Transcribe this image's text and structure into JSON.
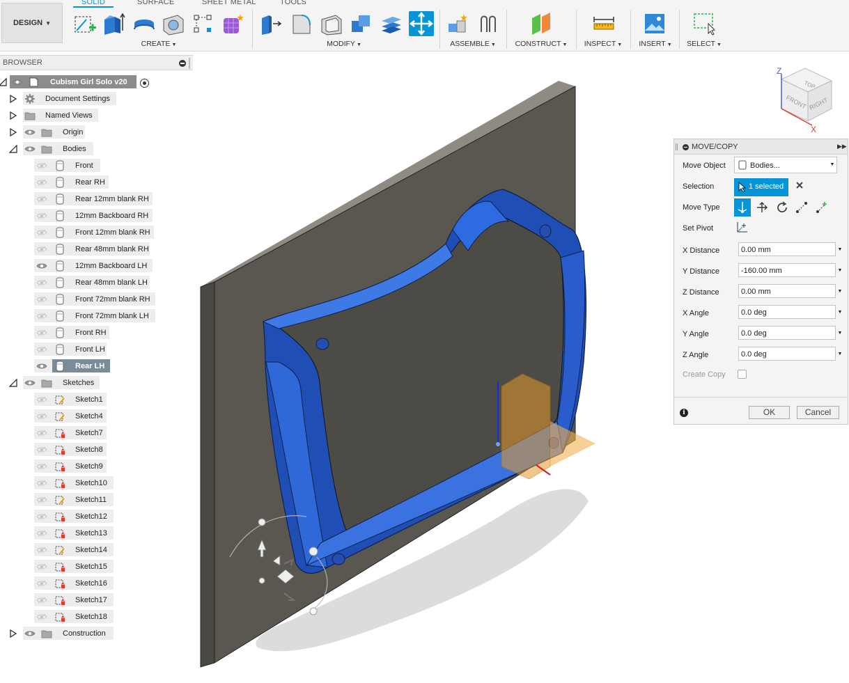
{
  "toolbar": {
    "design_label": "DESIGN",
    "tabs": [
      "SOLID",
      "SURFACE",
      "SHEET METAL",
      "TOOLS"
    ],
    "groups": [
      "CREATE",
      "MODIFY",
      "ASSEMBLE",
      "CONSTRUCT",
      "INSPECT",
      "INSERT",
      "SELECT"
    ]
  },
  "browser": {
    "header": "BROWSER",
    "root": "Cubism Girl Solo v20",
    "nodes": [
      "Document Settings",
      "Named Views",
      "Origin",
      "Bodies",
      "Sketches",
      "Construction"
    ],
    "bodies": [
      "Front",
      "Rear RH",
      "Rear 12mm blank RH",
      "12mm Backboard RH",
      "Front 12mm blank RH",
      "Rear 48mm blank RH",
      "12mm Backboard LH",
      "Rear 48mm blank LH",
      "Front  72mm blank RH",
      "Front  72mm blank LH",
      "Front RH",
      "Front LH",
      "Rear LH"
    ],
    "visible_bodies": [
      "12mm Backboard LH",
      "Rear LH"
    ],
    "selected_body": "Rear LH",
    "sketches": [
      "Sketch1",
      "Sketch4",
      "Sketch7",
      "Sketch8",
      "Sketch9",
      "Sketch10",
      "Sketch11",
      "Sketch12",
      "Sketch13",
      "Sketch14",
      "Sketch15",
      "Sketch16",
      "Sketch17",
      "Sketch18"
    ]
  },
  "viewcube": {
    "faces": [
      "TOP",
      "FRONT",
      "RIGHT"
    ],
    "axes": [
      "Z",
      "X"
    ]
  },
  "dialog": {
    "title": "MOVE/COPY",
    "move_object_label": "Move Object",
    "move_object_value": "Bodies...",
    "selection_label": "Selection",
    "selection_value": "1 selected",
    "move_type_label": "Move Type",
    "set_pivot_label": "Set Pivot",
    "fields": [
      {
        "label": "X Distance",
        "value": "0.00 mm"
      },
      {
        "label": "Y Distance",
        "value": "-160.00 mm"
      },
      {
        "label": "Z Distance",
        "value": "0.00 mm"
      },
      {
        "label": "X Angle",
        "value": "0.0 deg"
      },
      {
        "label": "Y Angle",
        "value": "0.0 deg"
      },
      {
        "label": "Z Angle",
        "value": "0.0 deg"
      }
    ],
    "create_copy_label": "Create Copy",
    "create_copy_checked": false,
    "ok_label": "OK",
    "cancel_label": "Cancel"
  },
  "colors": {
    "accent": "#0696d7",
    "body_blue": "#2f68d8",
    "board_gray": "#5a5750",
    "highlight_orange": "#e39a2b"
  }
}
